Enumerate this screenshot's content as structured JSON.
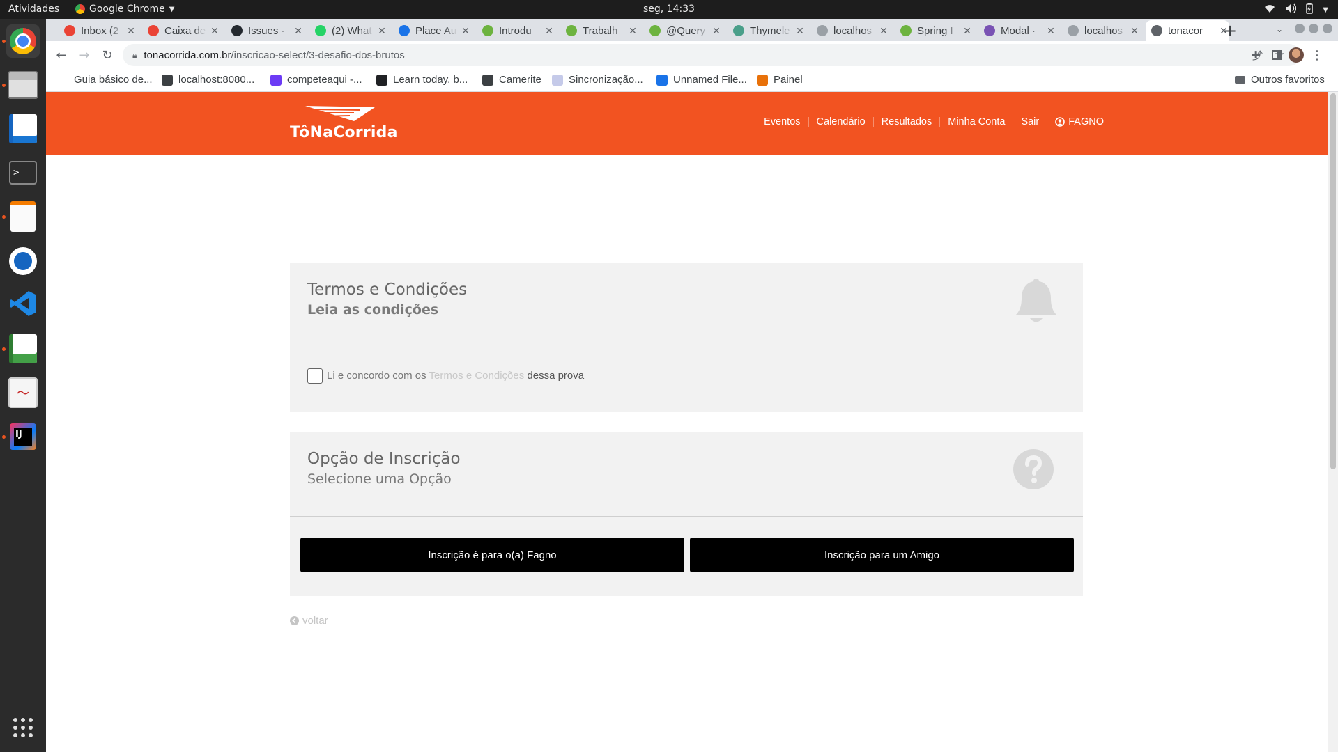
{
  "system": {
    "activities": "Atividades",
    "app_name": "Google Chrome",
    "clock": "seg, 14:33"
  },
  "browser": {
    "tabs": [
      {
        "title": "Inbox (2",
        "icon_color": "#ea4335"
      },
      {
        "title": "Caixa de",
        "icon_color": "#ea4335"
      },
      {
        "title": "Issues ·",
        "icon_color": "#24292f"
      },
      {
        "title": "(2) What",
        "icon_color": "#25d366"
      },
      {
        "title": "Place Au",
        "icon_color": "#1a73e8"
      },
      {
        "title": "Introdu",
        "icon_color": "#6db33f"
      },
      {
        "title": "Trabalh",
        "icon_color": "#6db33f"
      },
      {
        "title": "@Query",
        "icon_color": "#6db33f"
      },
      {
        "title": "Thymele",
        "icon_color": "#4a9f8a"
      },
      {
        "title": "localhos",
        "icon_color": "#9aa0a6"
      },
      {
        "title": "Spring I",
        "icon_color": "#6db33f"
      },
      {
        "title": "Modal ·",
        "icon_color": "#7952b3"
      },
      {
        "title": "localhos",
        "icon_color": "#9aa0a6"
      },
      {
        "title": "tonacor",
        "icon_color": "#5f6368"
      }
    ],
    "url_domain": "tonacorrida.com.br",
    "url_path": "/inscricao-select/3-desafio-dos-brutos",
    "bookmarks": [
      {
        "label": "Guia básico de...",
        "icon_color": "#00000000"
      },
      {
        "label": "localhost:8080...",
        "icon_color": "#3c4043"
      },
      {
        "label": "competeaqui -...",
        "icon_color": "#6c3bf5"
      },
      {
        "label": "Learn today, b...",
        "icon_color": "#202124"
      },
      {
        "label": "Camerite",
        "icon_color": "#3c4043"
      },
      {
        "label": "Sincronização...",
        "icon_color": "#c5cae9"
      },
      {
        "label": "Unnamed File...",
        "icon_color": "#1a73e8"
      },
      {
        "label": "Painel",
        "icon_color": "#e8710a"
      }
    ],
    "other_bookmarks": "Outros favoritos"
  },
  "site": {
    "logo_text": "TôNaCorrida",
    "brand_color": "#f25321",
    "nav": [
      "Eventos",
      "Calendário",
      "Resultados",
      "Minha Conta",
      "Sair"
    ],
    "user_name": "FAGNO"
  },
  "terms": {
    "title": "Termos e Condições",
    "subtitle": "Leia as condições",
    "prefix": "Li e concordo com os",
    "link": "Termos e Condições",
    "suffix": "dessa prova",
    "checked": false
  },
  "option": {
    "title": "Opção de Inscrição",
    "subtitle": "Selecione uma Opção",
    "self_button": "Inscrição é para o(a) Fagno",
    "friend_button": "Inscrição para um Amigo"
  },
  "back_label": "voltar"
}
